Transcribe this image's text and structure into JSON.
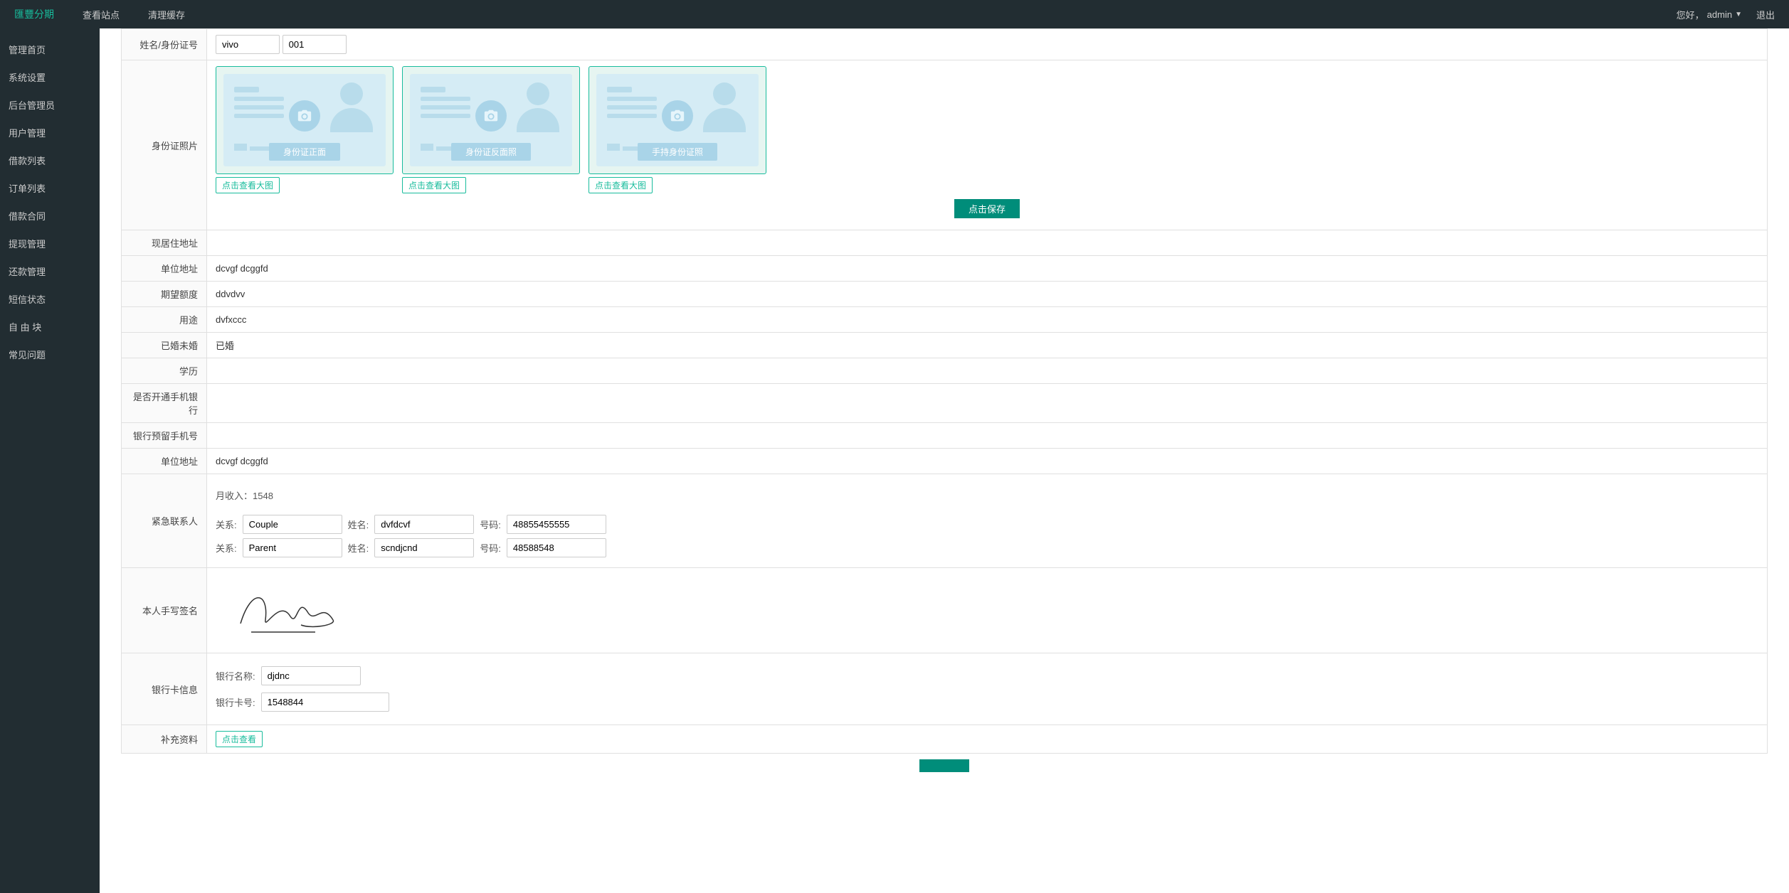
{
  "header": {
    "brand": "匯豐分期",
    "nav": {
      "view_site": "查看站点",
      "clear_cache": "清理缓存"
    },
    "user": {
      "greeting": "您好，",
      "name": "admin",
      "logout": "退出"
    }
  },
  "sidebar": {
    "items": [
      {
        "label": "管理首页"
      },
      {
        "label": "系统设置"
      },
      {
        "label": "后台管理员"
      },
      {
        "label": "用户管理"
      },
      {
        "label": "借款列表"
      },
      {
        "label": "订单列表"
      },
      {
        "label": "借款合同"
      },
      {
        "label": "提现管理"
      },
      {
        "label": "还款管理"
      },
      {
        "label": "短信状态"
      },
      {
        "label": "自 由 块"
      },
      {
        "label": "常见问题"
      }
    ]
  },
  "form": {
    "name_id": {
      "label": "姓名/身份证号",
      "name": "vivo",
      "id": "001"
    },
    "id_photos": {
      "label": "身份证照片",
      "cards": [
        {
          "caption": "身份证正面"
        },
        {
          "caption": "身份证反面照"
        },
        {
          "caption": "手持身份证照"
        }
      ],
      "view_btn": "点击查看大图",
      "save_btn": "点击保存"
    },
    "current_address": {
      "label": "现居住地址",
      "value": ""
    },
    "company_address": {
      "label": "单位地址",
      "value": "dcvgf dcggfd"
    },
    "expected_amount": {
      "label": "期望额度",
      "value": "ddvdvv"
    },
    "purpose": {
      "label": "用途",
      "value": "dvfxccc"
    },
    "marital": {
      "label": "已婚未婚",
      "value": "已婚"
    },
    "education": {
      "label": "学历",
      "value": ""
    },
    "mobile_bank": {
      "label": "是否开通手机银行",
      "value": ""
    },
    "bank_phone": {
      "label": "银行预留手机号",
      "value": ""
    },
    "company_address2": {
      "label": "单位地址",
      "value": "dcvgf dcggfd"
    },
    "emergency": {
      "label": "紧急联系人",
      "monthly_label": "月收入：",
      "monthly_value": "1548",
      "relation_label": "关系:",
      "name_label": "姓名:",
      "phone_label": "号码:",
      "contacts": [
        {
          "relation": "Couple",
          "name": "dvfdcvf",
          "phone": "48855455555"
        },
        {
          "relation": "Parent",
          "name": "scndjcnd",
          "phone": "48588548"
        }
      ]
    },
    "signature": {
      "label": "本人手写签名"
    },
    "bank_card": {
      "label": "银行卡信息",
      "bank_name_label": "银行名称:",
      "bank_name": "djdnc",
      "card_no_label": "银行卡号:",
      "card_no": "1548844"
    },
    "extra": {
      "label": "补充资料",
      "view_btn": "点击查看"
    }
  }
}
